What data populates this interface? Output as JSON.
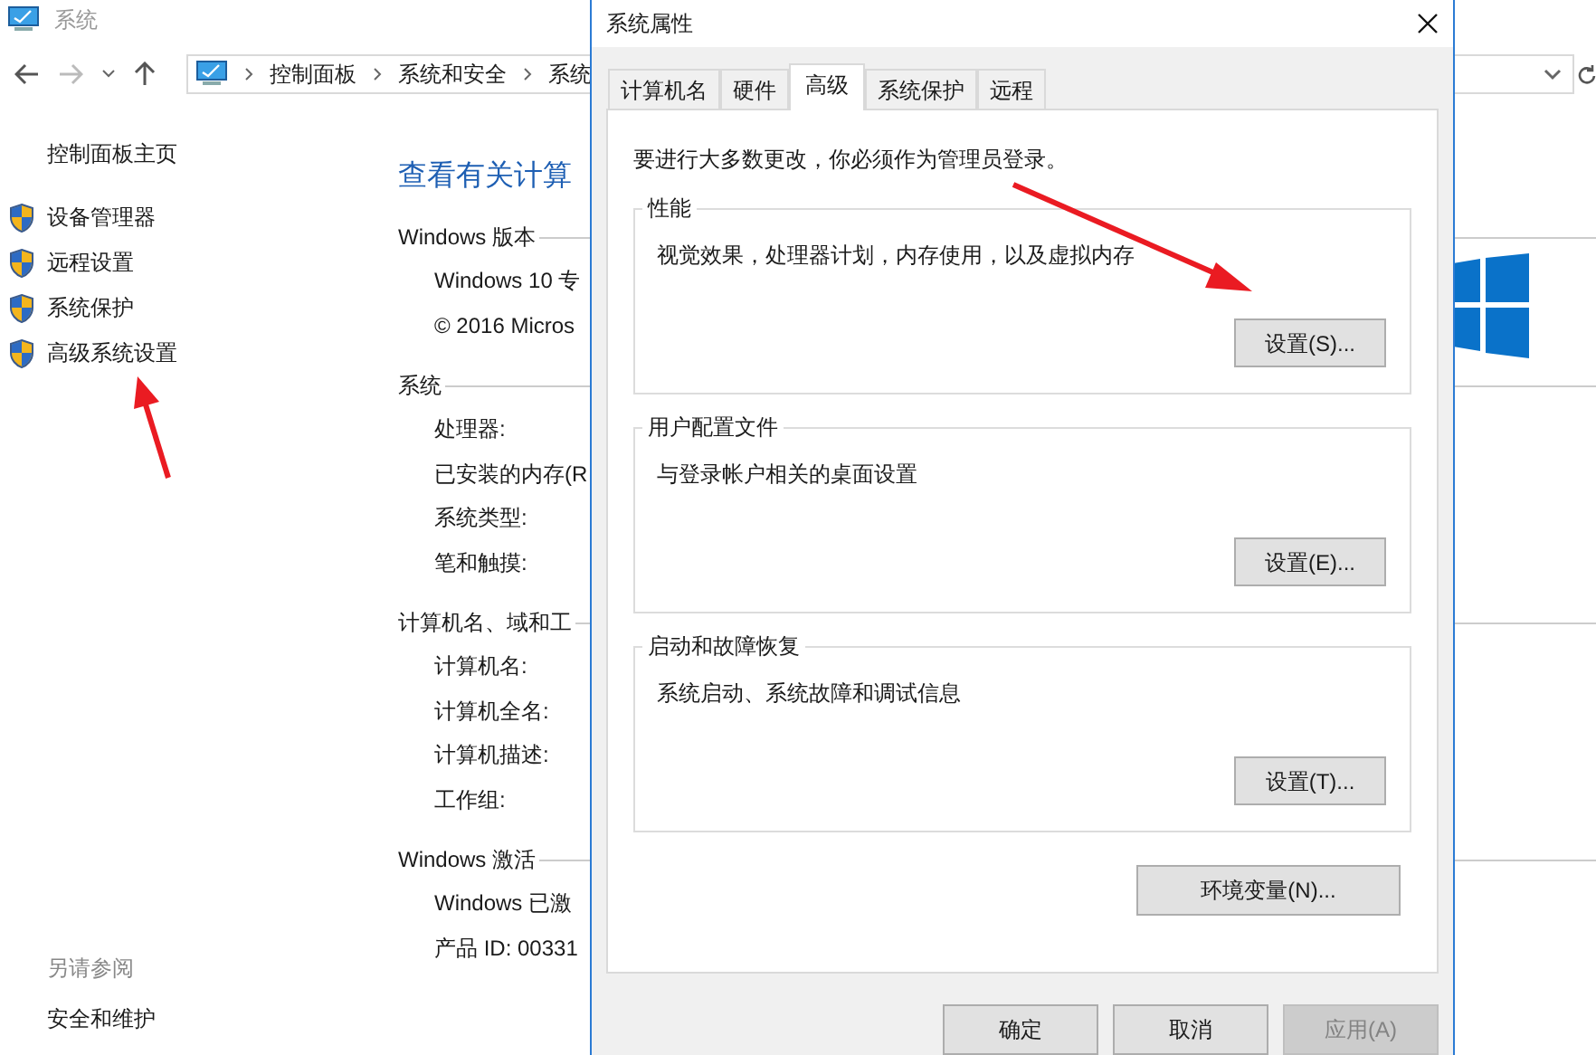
{
  "window": {
    "title": "系统"
  },
  "nav": {
    "breadcrumb": [
      "控制面板",
      "系统和安全",
      "系统"
    ]
  },
  "left_pane": {
    "home": "控制面板主页",
    "tasks": [
      "设备管理器",
      "远程设置",
      "系统保护",
      "高级系统设置"
    ],
    "see_also_title": "另请参阅",
    "see_also": [
      "安全和维护"
    ]
  },
  "main": {
    "heading": "查看有关计算",
    "sections": [
      {
        "title": "Windows 版本",
        "rows": [
          "Windows 10 专",
          "© 2016 Micros"
        ]
      },
      {
        "title": "系统",
        "rows": [
          "处理器:",
          "已安装的内存(R",
          "系统类型:",
          "笔和触摸:"
        ]
      },
      {
        "title": "计算机名、域和工",
        "rows": [
          "计算机名:",
          "计算机全名:",
          "计算机描述:",
          "工作组:"
        ]
      },
      {
        "title": "Windows 激活",
        "rows": [
          "Windows 已激",
          "产品 ID: 00331"
        ]
      }
    ]
  },
  "dialog": {
    "title": "系统属性",
    "tabs": [
      {
        "label": "计算机名",
        "selected": false
      },
      {
        "label": "硬件",
        "selected": false
      },
      {
        "label": "高级",
        "selected": true
      },
      {
        "label": "系统保护",
        "selected": false
      },
      {
        "label": "远程",
        "selected": false
      }
    ],
    "notice": "要进行大多数更改，你必须作为管理员登录。",
    "groups": [
      {
        "title": "性能",
        "description": "视觉效果，处理器计划，内存使用，以及虚拟内存",
        "button": "设置(S)..."
      },
      {
        "title": "用户配置文件",
        "description": "与登录帐户相关的桌面设置",
        "button": "设置(E)..."
      },
      {
        "title": "启动和故障恢复",
        "description": "系统启动、系统故障和调试信息",
        "button": "设置(T)..."
      }
    ],
    "env_button": "环境变量(N)...",
    "footer_buttons": [
      {
        "label": "确定",
        "disabled": false
      },
      {
        "label": "取消",
        "disabled": false
      },
      {
        "label": "应用(A)",
        "disabled": true
      }
    ]
  }
}
